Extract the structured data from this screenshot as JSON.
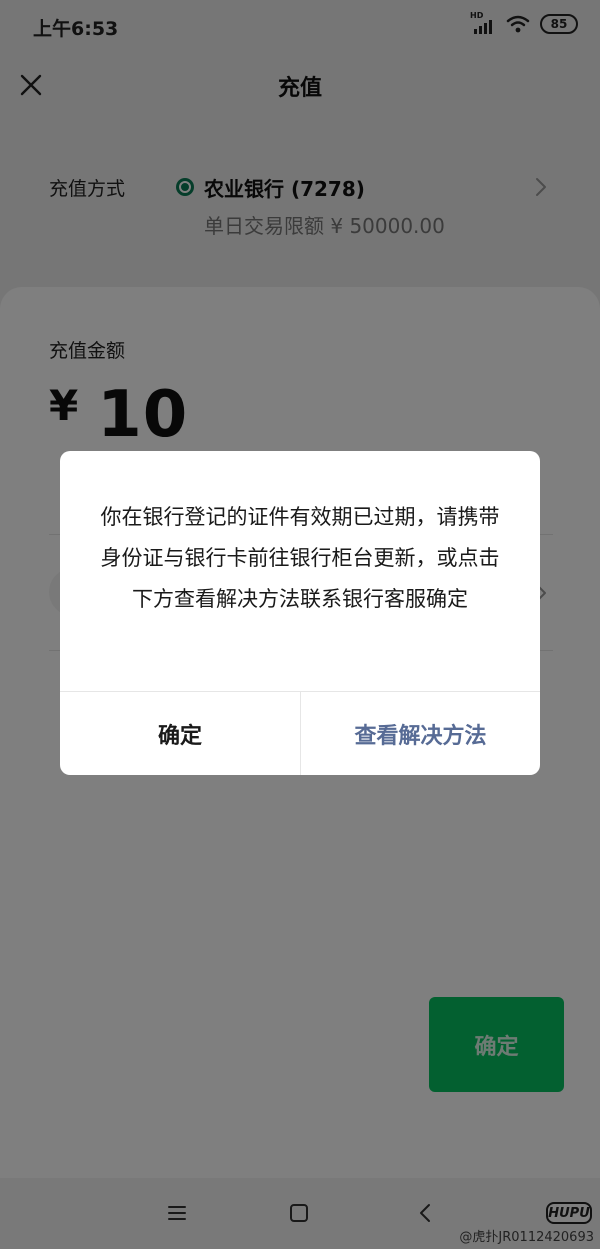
{
  "status_bar": {
    "time": "上午6:53",
    "signal_label": "HD",
    "battery": "85"
  },
  "header": {
    "title": "充值",
    "close_icon": "close-icon"
  },
  "payment_method": {
    "label": "充值方式",
    "bank_name": "农业银行 (7278)",
    "daily_limit": "单日交易限额 ¥ 50000.00",
    "bank_icon_color": "#0a7a55"
  },
  "amount": {
    "label": "充值金额",
    "currency": "¥",
    "value": "10"
  },
  "confirm_button": {
    "label": "确定",
    "color": "#07c160"
  },
  "dialog": {
    "message": "你在银行登记的证件有效期已过期，请携带身份证与银行卡前往银行柜台更新，或点击下方查看解决方法联系银行客服确定",
    "confirm_label": "确定",
    "solution_label": "查看解决方法",
    "solution_color": "#576b95"
  },
  "nav_bar": {
    "logo": "HUPU",
    "watermark": "@虎扑JR0112420693"
  }
}
